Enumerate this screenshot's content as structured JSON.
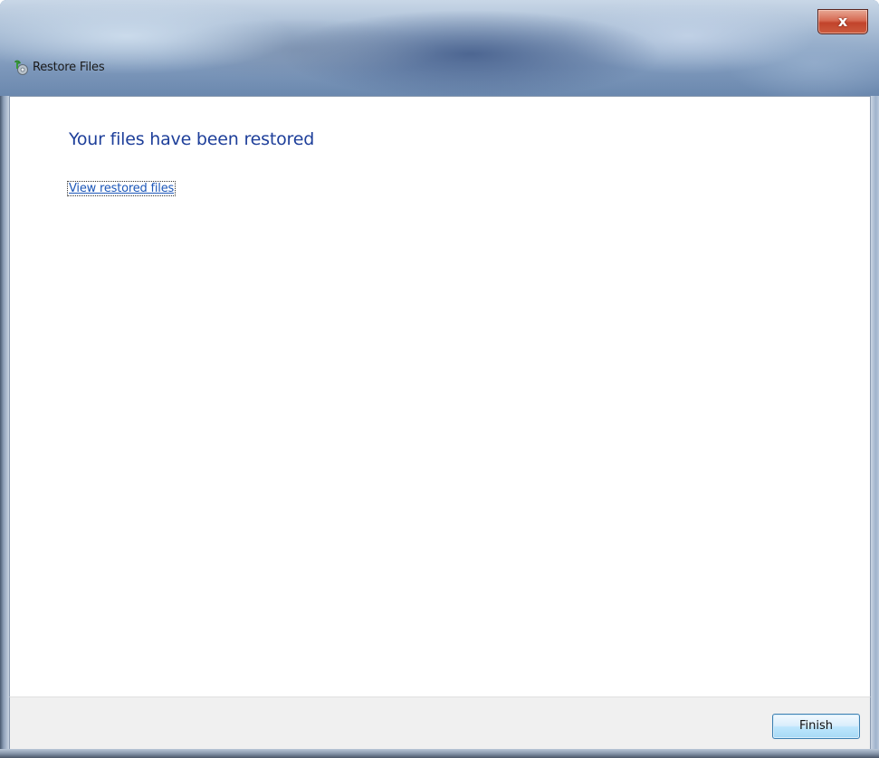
{
  "window": {
    "title": "Restore Files",
    "close_symbol": "x",
    "icon": "restore-files-icon"
  },
  "main": {
    "heading": "Your files have been restored",
    "link_label": "View restored files"
  },
  "footer": {
    "finish_label": "Finish"
  },
  "colors": {
    "heading": "#1e3f9a",
    "link": "#1b56b8",
    "footer_bg": "#f0f0f0",
    "close_button": "#c1432b",
    "button_border": "#3c7fb1"
  }
}
